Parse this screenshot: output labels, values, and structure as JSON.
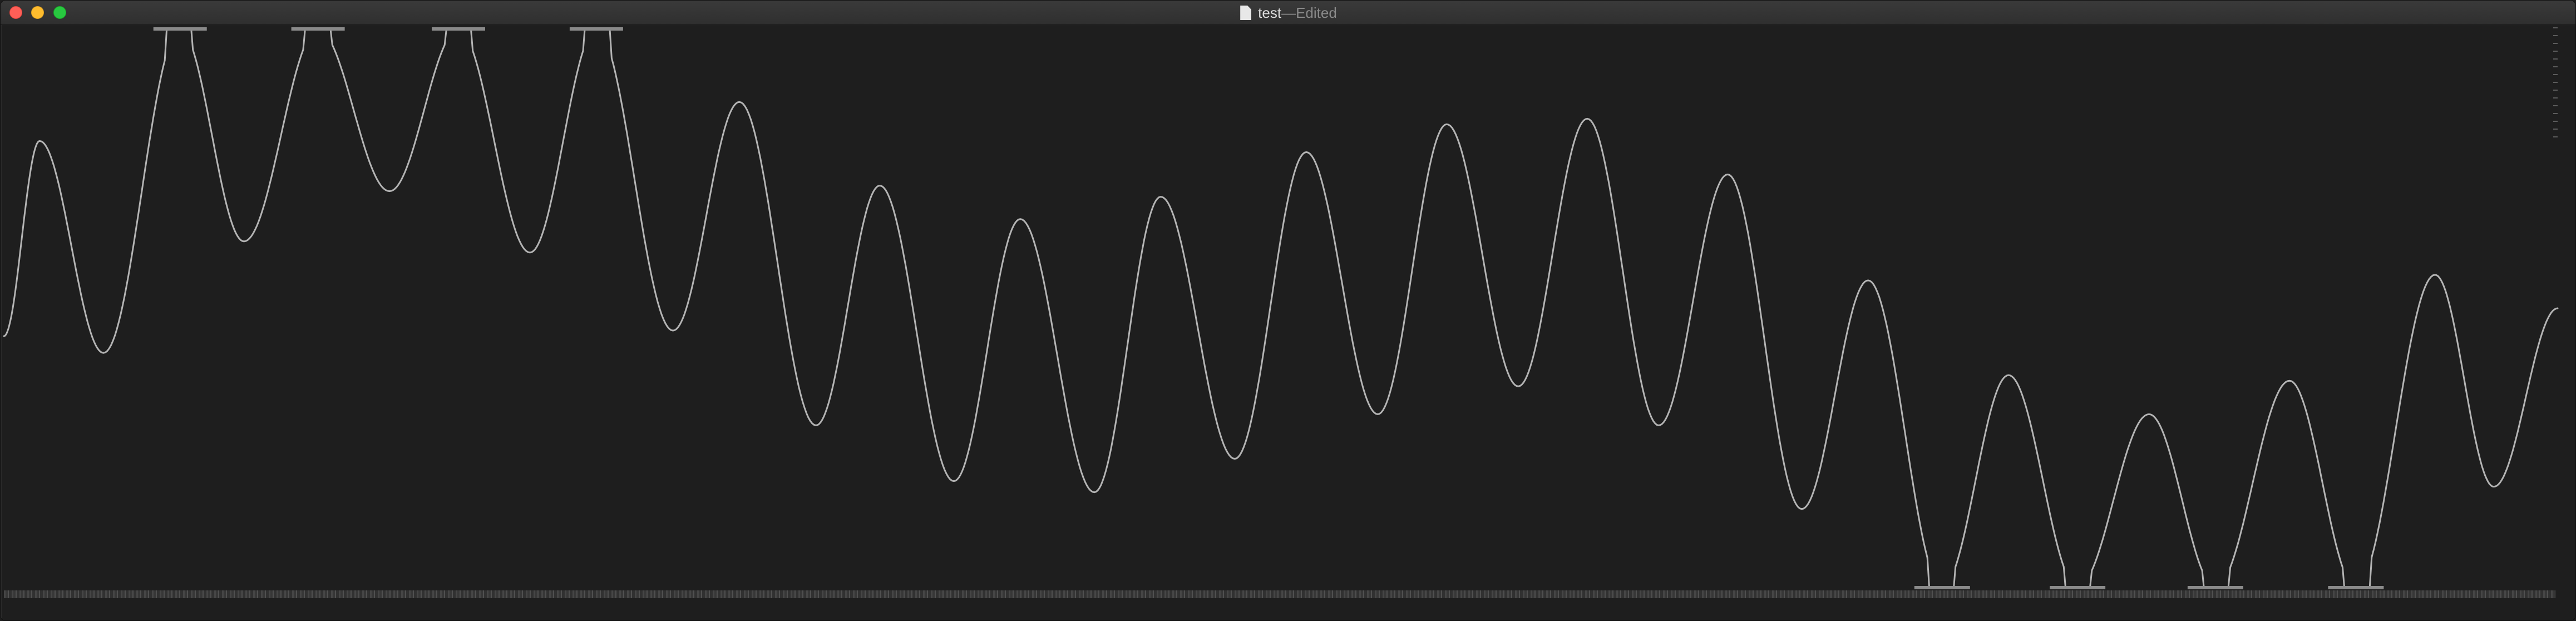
{
  "window": {
    "title": "test",
    "separator": " — ",
    "status": "Edited"
  },
  "icons": {
    "close": "close-icon",
    "minimize": "minimize-icon",
    "zoom": "zoom-icon",
    "document": "document-icon"
  },
  "colors": {
    "background": "#1e1e1e",
    "titlebar": "#2f2f2f",
    "waveform": "#b4b4b4",
    "close": "#fe5f57",
    "minimize": "#febc2e",
    "zoom": "#28c840"
  },
  "waveform": {
    "peaks": [
      {
        "t": 0.0,
        "v": 0.45
      },
      {
        "t": 0.014,
        "v": 0.8
      },
      {
        "t": 0.039,
        "v": 0.42
      },
      {
        "t": 0.069,
        "v": 1.0,
        "clip": true
      },
      {
        "t": 0.094,
        "v": 0.62
      },
      {
        "t": 0.123,
        "v": 1.0,
        "clip": true
      },
      {
        "t": 0.151,
        "v": 0.71
      },
      {
        "t": 0.178,
        "v": 1.0,
        "clip": true
      },
      {
        "t": 0.206,
        "v": 0.6
      },
      {
        "t": 0.232,
        "v": 1.0,
        "clip": true
      },
      {
        "t": 0.262,
        "v": 0.46
      },
      {
        "t": 0.288,
        "v": 0.87
      },
      {
        "t": 0.318,
        "v": 0.29
      },
      {
        "t": 0.343,
        "v": 0.72
      },
      {
        "t": 0.372,
        "v": 0.19
      },
      {
        "t": 0.398,
        "v": 0.66
      },
      {
        "t": 0.427,
        "v": 0.17
      },
      {
        "t": 0.453,
        "v": 0.7
      },
      {
        "t": 0.482,
        "v": 0.23
      },
      {
        "t": 0.51,
        "v": 0.78
      },
      {
        "t": 0.538,
        "v": 0.31
      },
      {
        "t": 0.565,
        "v": 0.83
      },
      {
        "t": 0.593,
        "v": 0.36
      },
      {
        "t": 0.62,
        "v": 0.84
      },
      {
        "t": 0.648,
        "v": 0.29
      },
      {
        "t": 0.675,
        "v": 0.74
      },
      {
        "t": 0.704,
        "v": 0.14
      },
      {
        "t": 0.73,
        "v": 0.55
      },
      {
        "t": 0.759,
        "v": 0.0,
        "clip": true
      },
      {
        "t": 0.785,
        "v": 0.38
      },
      {
        "t": 0.812,
        "v": 0.0,
        "clip": true
      },
      {
        "t": 0.84,
        "v": 0.31
      },
      {
        "t": 0.866,
        "v": 0.0,
        "clip": true
      },
      {
        "t": 0.895,
        "v": 0.37
      },
      {
        "t": 0.921,
        "v": 0.0,
        "clip": true
      },
      {
        "t": 0.952,
        "v": 0.56
      },
      {
        "t": 0.975,
        "v": 0.18
      },
      {
        "t": 1.0,
        "v": 0.5
      }
    ]
  }
}
